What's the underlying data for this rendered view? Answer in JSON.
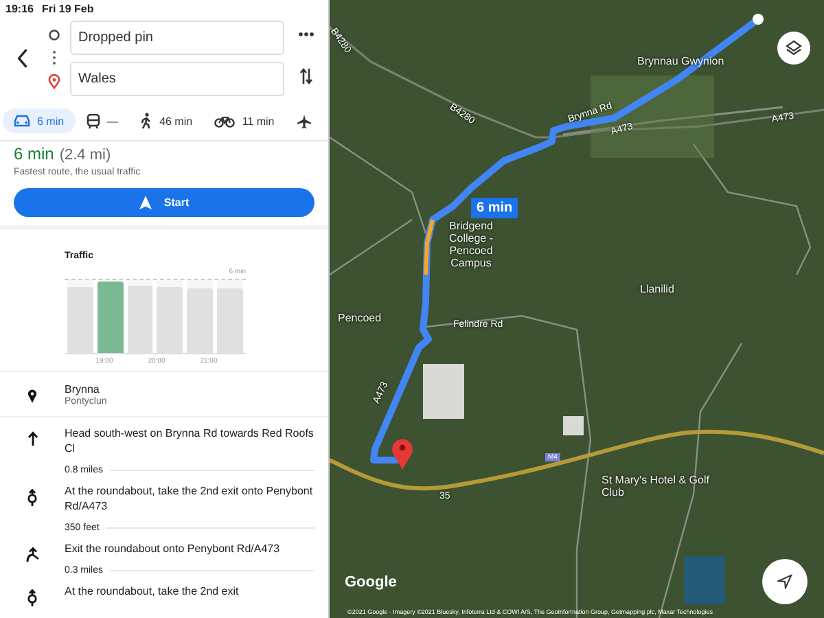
{
  "status_bar": {
    "time": "19:16",
    "date": "Fri 19 Feb"
  },
  "route_inputs": {
    "origin": "Dropped pin",
    "destination": "Wales"
  },
  "modes": [
    {
      "kind": "car",
      "label": "6 min",
      "selected": true
    },
    {
      "kind": "transit",
      "label": "—",
      "selected": false
    },
    {
      "kind": "walk",
      "label": "46 min",
      "selected": false
    },
    {
      "kind": "bike",
      "label": "11 min",
      "selected": false
    },
    {
      "kind": "flight",
      "selected": false
    }
  ],
  "summary": {
    "duration": "6 min",
    "distance": "(2.4 mi)",
    "note": "Fastest route, the usual traffic",
    "start_button": "Start"
  },
  "traffic": {
    "title": "Traffic",
    "max_label": "6 min",
    "bars": [
      {
        "level": 0.93,
        "selected": false
      },
      {
        "level": 1.0,
        "selected": true
      },
      {
        "level": 0.95,
        "selected": false
      },
      {
        "level": 0.93,
        "selected": false
      },
      {
        "level": 0.91,
        "selected": false
      },
      {
        "level": 0.9,
        "selected": false
      }
    ],
    "hours": [
      "19:00",
      "20:00",
      "21:00"
    ]
  },
  "directions": [
    {
      "kind": "place",
      "title": "Brynna",
      "subtitle": "Pontyclun"
    },
    {
      "kind": "straight",
      "text": "Head south-west on Brynna Rd towards Red Roofs Cl",
      "distance": "0.8 miles"
    },
    {
      "kind": "roundabout",
      "text": "At the roundabout, take the 2nd exit onto Penybont Rd/A473",
      "distance": "350 feet"
    },
    {
      "kind": "exit",
      "text": "Exit the roundabout onto Penybont Rd/A473",
      "distance": "0.3 miles"
    },
    {
      "kind": "roundabout",
      "text": "At the roundabout, take the 2nd exit"
    }
  ],
  "map": {
    "route_label": "6 min",
    "labels": [
      "B4280",
      "Brynnau Gwynion",
      "Brynna Rd",
      "A473",
      "A473",
      "B4280",
      "Bridgend College - Pencoed Campus",
      "Llanilid",
      "Pencoed",
      "Felindre Rd",
      "A473",
      "M4",
      "35",
      "St Mary's Hotel & Golf Club"
    ],
    "logo": "Google",
    "copyright": "©2021 Google · Imagery ©2021 Bluesky, Infoterra Ltd & COWI A/S, The GeoInformation Group, Getmapping plc, Maxar Technologies"
  }
}
